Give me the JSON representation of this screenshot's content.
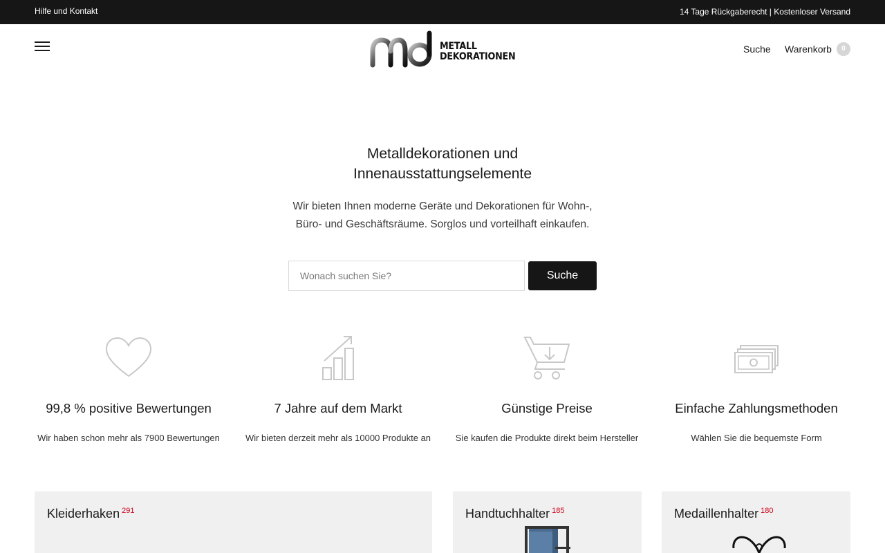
{
  "topbar": {
    "help": "Hilfe und Kontakt",
    "info": "14 Tage Rückgaberecht | Kostenloser Versand"
  },
  "header": {
    "logo_line1": "METALL",
    "logo_line2": "DEKORATIONEN",
    "search_label": "Suche",
    "cart_label": "Warenkorb",
    "cart_count": "0"
  },
  "hero": {
    "title_line1": "Metalldekorationen und",
    "title_line2": "Innenausstattungselemente",
    "sub_line1": "Wir bieten Ihnen moderne Geräte und Dekorationen für Wohn-,",
    "sub_line2": "Büro- und Geschäftsräume. Sorglos und vorteilhaft einkaufen.",
    "search_placeholder": "Wonach suchen Sie?",
    "search_button": "Suche"
  },
  "features": [
    {
      "icon": "heart-icon",
      "title": "99,8 % positive Bewertungen",
      "desc": "Wir haben schon mehr als 7900 Bewertungen"
    },
    {
      "icon": "growth-chart-icon",
      "title": "7 Jahre auf dem Markt",
      "desc": "Wir bieten derzeit mehr als 10000 Produkte an"
    },
    {
      "icon": "cart-download-icon",
      "title": "Günstige Preise",
      "desc": "Sie kaufen die Produkte direkt beim Hersteller"
    },
    {
      "icon": "money-icon",
      "title": "Einfache Zahlungsmethoden",
      "desc": "Wählen Sie die bequemste Form"
    }
  ],
  "categories": [
    {
      "name": "Kleiderhaken",
      "count": "291"
    },
    {
      "name": "Handtuchhalter",
      "count": "185"
    },
    {
      "name": "Medaillenhalter",
      "count": "180"
    }
  ],
  "colors": {
    "topbar_bg": "#161616",
    "button_bg": "#161616",
    "card_bg": "#f0f0f0",
    "count_red": "#d0021b",
    "icon_gray": "#c8c8c8"
  }
}
